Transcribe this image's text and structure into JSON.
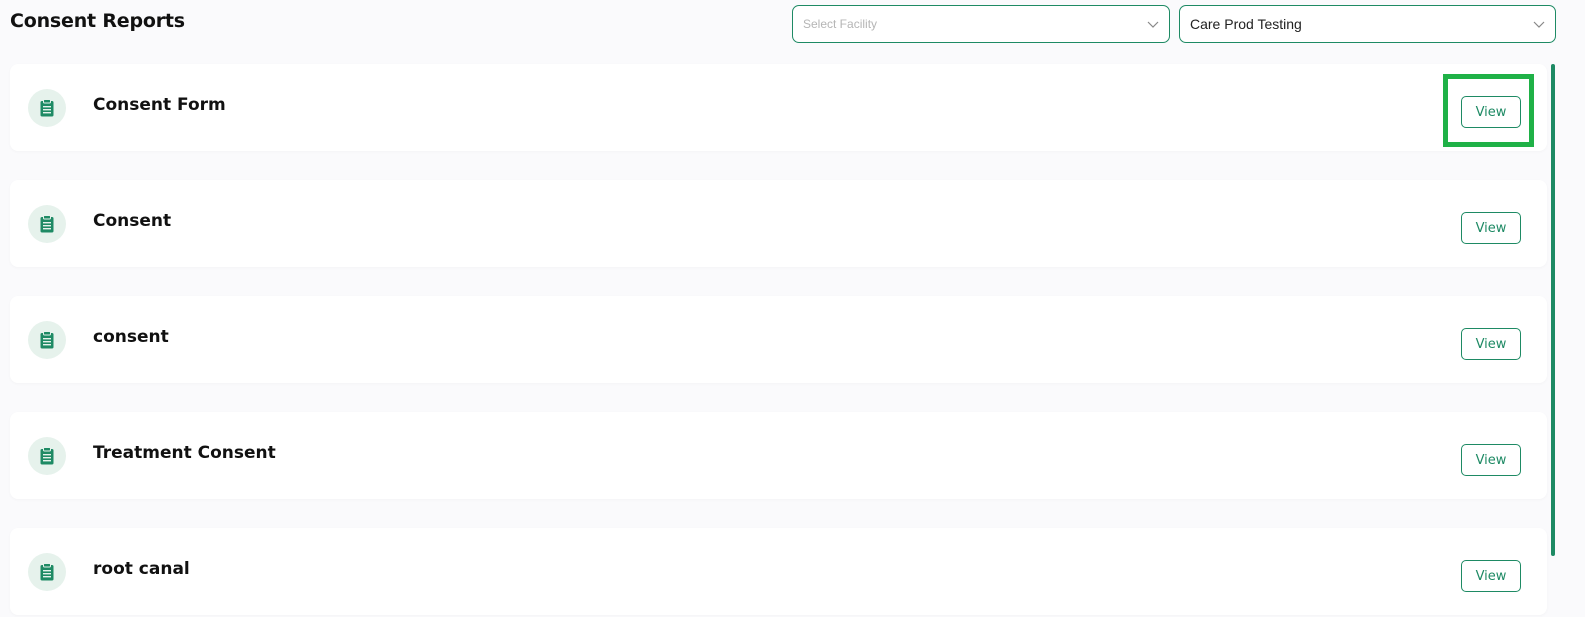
{
  "header": {
    "title": "Consent Reports",
    "facility_select": {
      "placeholder": "Select Facility",
      "value": ""
    },
    "org_select": {
      "value": "Care Prod Testing"
    }
  },
  "reports": [
    {
      "name": "Consent Form",
      "action_label": "View",
      "icon": "clipboard-icon"
    },
    {
      "name": "Consent",
      "action_label": "View",
      "icon": "clipboard-icon"
    },
    {
      "name": "consent",
      "action_label": "View",
      "icon": "clipboard-icon"
    },
    {
      "name": "Treatment Consent",
      "action_label": "View",
      "icon": "clipboard-icon"
    },
    {
      "name": "root canal",
      "action_label": "View",
      "icon": "clipboard-icon"
    }
  ],
  "colors": {
    "accent": "#1e8a64",
    "icon_bg": "#e6f2ec",
    "highlight": "#1fb147",
    "page_bg": "#fafafc"
  }
}
